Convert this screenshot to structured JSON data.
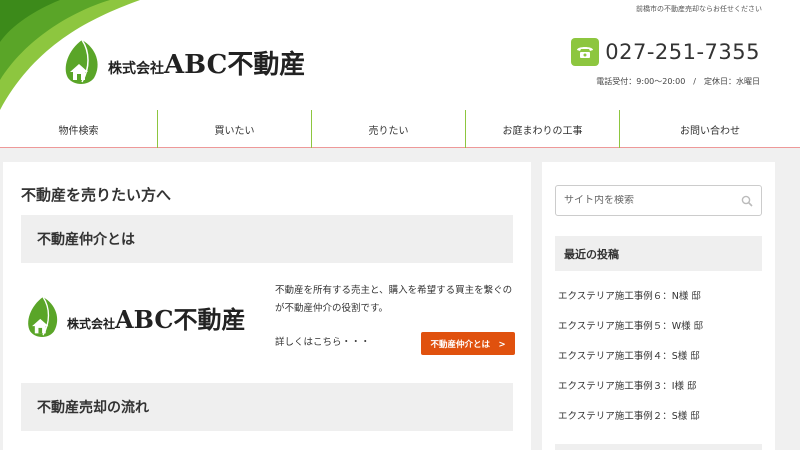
{
  "header": {
    "tagline": "前橋市の不動産売却ならお任せください",
    "logo_small": "株式会社",
    "logo_big": "ABC不動産",
    "phone": "027-251-7355",
    "hours": "電話受付：9:00〜20:00　/　定休日：水曜日",
    "accent_color": "#8dc63f"
  },
  "nav": {
    "items": [
      "物件検索",
      "買いたい",
      "売りたい",
      "お庭まわりの工事",
      "お問い合わせ"
    ]
  },
  "main": {
    "page_title": "不動産を売りたい方へ",
    "section1_title": "不動産仲介とは",
    "description": "不動産を所有する売主と、購入を希望する買主を繋ぐのが不動産仲介の役割です。",
    "more_text": "詳しくはこちら・・・",
    "button_label": "不動産仲介とは　>",
    "section2_title": "不動産売却の流れ",
    "button_color": "#e0510e"
  },
  "sidebar": {
    "search_placeholder": "サイト内を検索",
    "recent_title": "最近の投稿",
    "posts": [
      "エクステリア施工事例６：N様 邸",
      "エクステリア施工事例５：W様 邸",
      "エクステリア施工事例４：S様 邸",
      "エクステリア施工事例３：I様 邸",
      "エクステリア施工事例２：S様 邸"
    ]
  }
}
